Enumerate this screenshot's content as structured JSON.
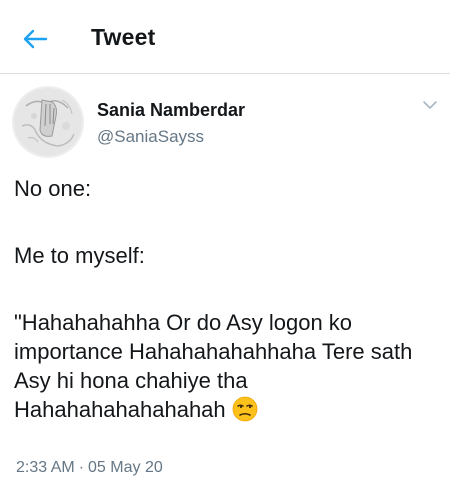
{
  "header": {
    "title": "Tweet",
    "back_icon": "arrow-left-icon",
    "accent_color": "#1da1f2"
  },
  "tweet": {
    "author_name": "Sania Namberdar",
    "author_handle": "@SaniaSayss",
    "menu_icon": "chevron-down-icon",
    "paragraphs": [
      "No one:",
      "Me to myself:",
      "\"Hahahahahha Or do Asy logon ko importance Hahahahahahhaha Tere sath Asy hi hona chahiye tha Hahahahahahahahah"
    ],
    "emoji": "unamused-face-icon",
    "time": "2:33 AM",
    "separator": "·",
    "date": "05 May 20"
  }
}
